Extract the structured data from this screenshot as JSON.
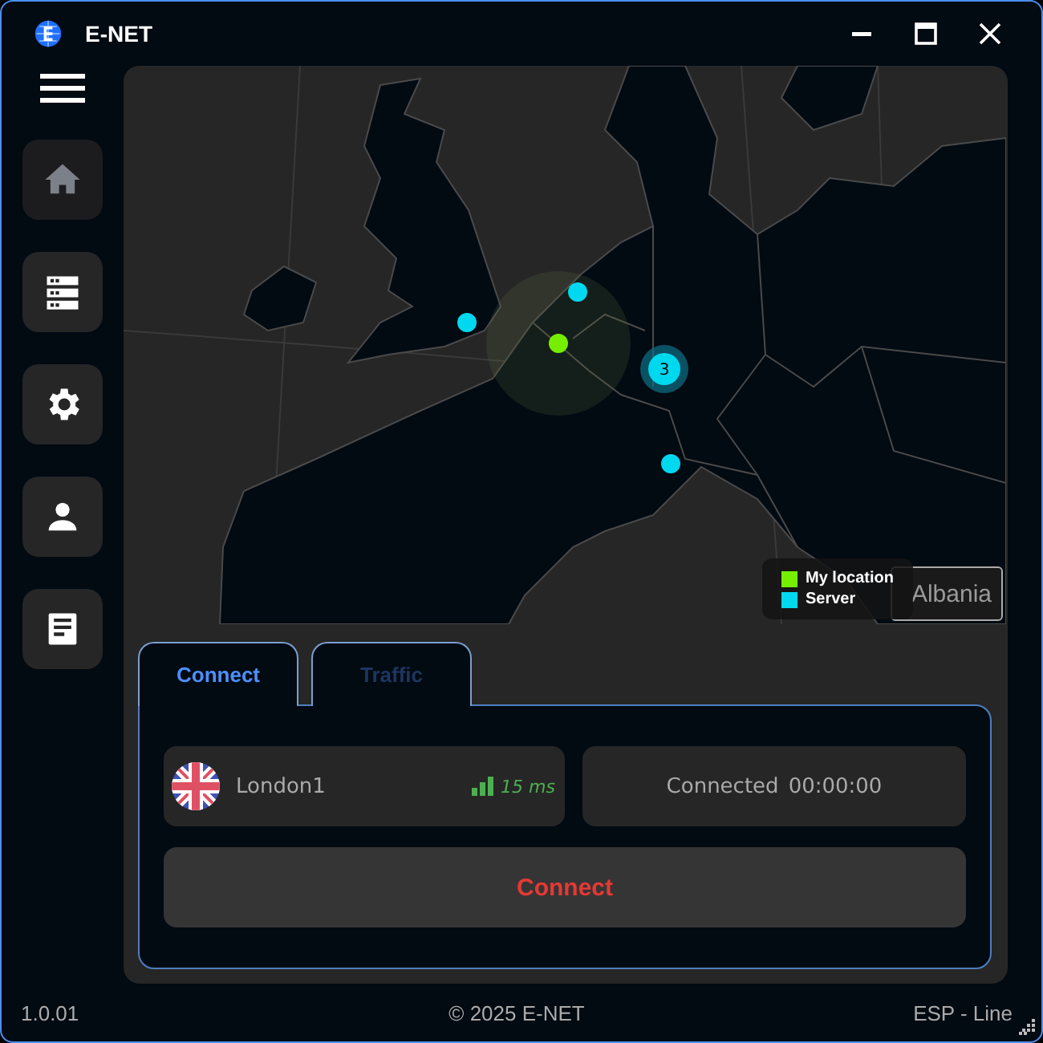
{
  "window": {
    "title": "E-NET"
  },
  "sidebar": {
    "items": [
      {
        "kind": "home",
        "selected": true
      },
      {
        "kind": "servers",
        "selected": false
      },
      {
        "kind": "settings",
        "selected": false
      },
      {
        "kind": "account",
        "selected": false
      },
      {
        "kind": "logs",
        "selected": false
      }
    ]
  },
  "map": {
    "markers": [
      {
        "kind": "server"
      },
      {
        "kind": "server"
      },
      {
        "kind": "my_location"
      },
      {
        "kind": "cluster",
        "count": "3"
      },
      {
        "kind": "server"
      }
    ],
    "legend": [
      {
        "label": "My location",
        "color": "#76ee00"
      },
      {
        "label": "Server",
        "color": "#00d8f0"
      }
    ],
    "tooltip": "Albania"
  },
  "tabs": [
    {
      "label": "Connect",
      "selected": true
    },
    {
      "label": "Traffic",
      "selected": false
    }
  ],
  "server": {
    "name": "London1",
    "ping": "15 ms"
  },
  "status": {
    "label": "Connected",
    "time": "00:00:00"
  },
  "connect_button": "Connect",
  "status_bar": {
    "version": "1.0.01",
    "copyright": "© 2025 E-NET",
    "region": "ESP - Line"
  }
}
